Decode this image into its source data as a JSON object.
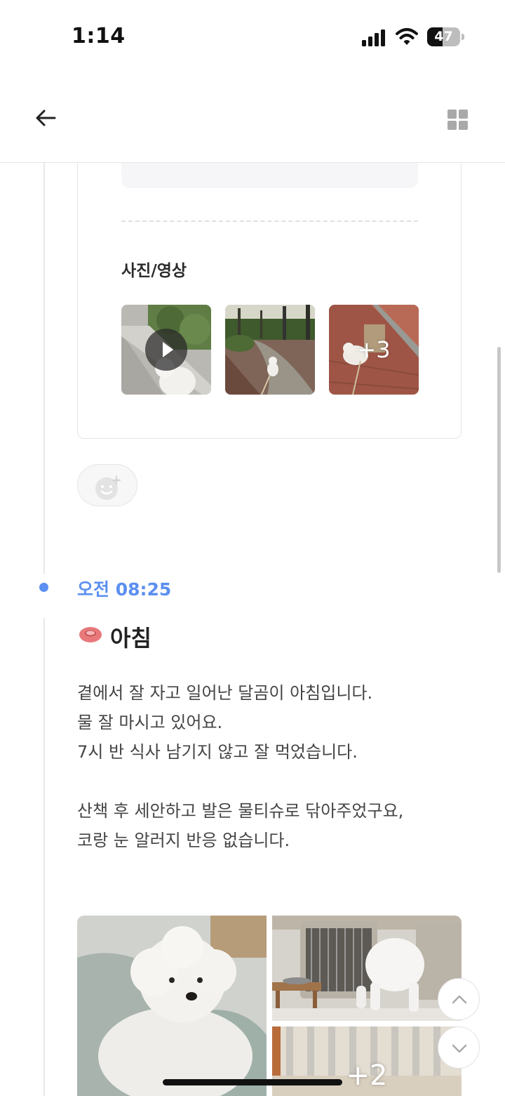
{
  "status_bar": {
    "time": "1:14",
    "battery": "47",
    "battery_level": 0.47
  },
  "card": {
    "media_section_label": "사진/영상",
    "extra_media_count": "+3"
  },
  "entry": {
    "time": "오전 08:25",
    "title": "아침",
    "icon": "food-bowl-icon",
    "body_lines": [
      "곁에서 잘 자고 일어난 달곰이 아침입니다.",
      "물 잘 마시고 있어요.",
      "7시 반 식사 남기지 않고 잘 먹었습니다.",
      "",
      "산책 후 세안하고 발은 물티슈로 닦아주었구요,",
      "코랑 눈 알러지 반응 없습니다."
    ],
    "extra_photo_count": "+2"
  },
  "colors": {
    "accent": "#5b8ff0",
    "bowl": "#e8787a"
  }
}
